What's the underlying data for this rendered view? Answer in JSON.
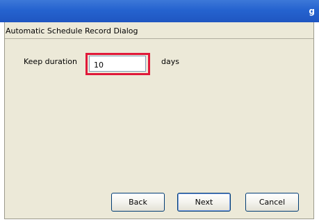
{
  "window": {
    "title_fragment": "g"
  },
  "dialog": {
    "title": "Automatic Schedule Record Dialog",
    "keep_duration": {
      "label": "Keep duration",
      "value": "10",
      "units": "days"
    },
    "buttons": {
      "back": "Back",
      "next": "Next",
      "cancel": "Cancel"
    }
  },
  "colors": {
    "titlebar": "#2563cf",
    "dialog_bg": "#ece9d8",
    "highlight": "#e0193a"
  }
}
